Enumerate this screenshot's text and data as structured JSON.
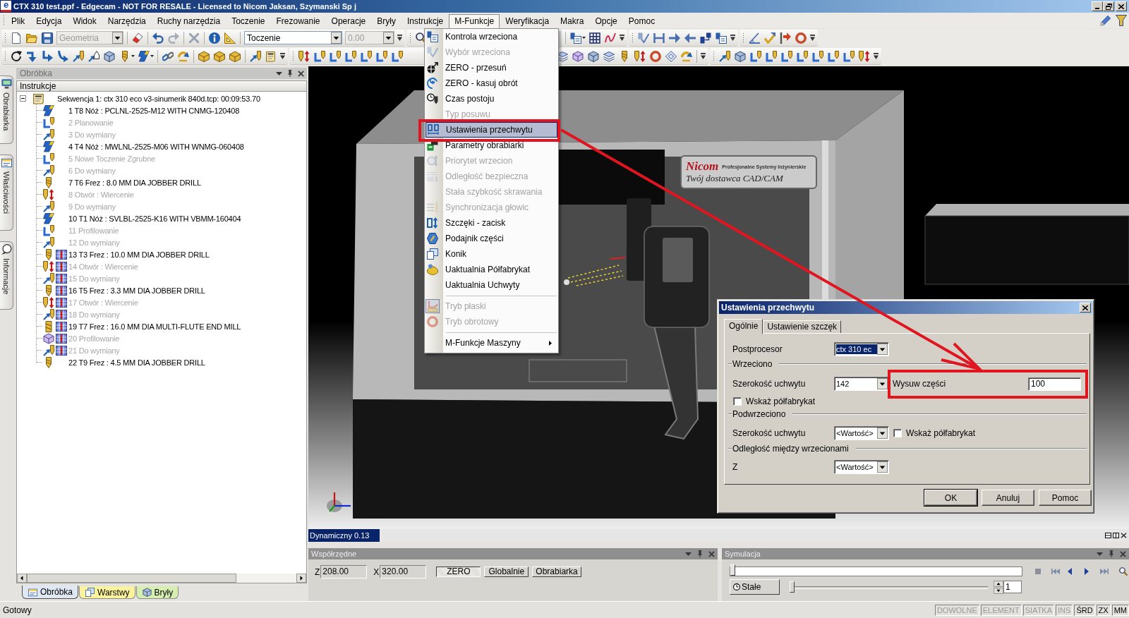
{
  "title_bar": {
    "logo": "e",
    "title": "CTX 310 test.ppf - Edgecam - NOT FOR RESALE - Licensed to Nicom Jaksan, Szymanski Sp j"
  },
  "menu_bar": [
    {
      "label": "Plik",
      "selected": false
    },
    {
      "label": "Edycja",
      "selected": false
    },
    {
      "label": "Widok",
      "selected": false
    },
    {
      "label": "Narzędzia",
      "selected": false
    },
    {
      "label": "Ruchy narzędzia",
      "selected": false
    },
    {
      "label": "Toczenie",
      "selected": false
    },
    {
      "label": "Frezowanie",
      "selected": false
    },
    {
      "label": "Operacje",
      "selected": false
    },
    {
      "label": "Bryły",
      "selected": false
    },
    {
      "label": "Instrukcje",
      "selected": false
    },
    {
      "label": "M-Funkcje",
      "selected": true
    },
    {
      "label": "Weryfikacja",
      "selected": false
    },
    {
      "label": "Makra",
      "selected": false
    },
    {
      "label": "Opcje",
      "selected": false
    },
    {
      "label": "Pomoc",
      "selected": false
    }
  ],
  "menu": {
    "sections": [
      {
        "items": [
          {
            "label": "Kontrola wrzeciona",
            "disabled": false,
            "selected": false,
            "checked": false,
            "submenu": false
          },
          {
            "label": "Wybór wrzeciona",
            "disabled": true,
            "selected": false,
            "checked": false,
            "submenu": false
          },
          {
            "label": "ZERO - przesuń",
            "disabled": false,
            "selected": false,
            "checked": false,
            "submenu": false
          },
          {
            "label": "ZERO - kasuj obrót",
            "disabled": false,
            "selected": false,
            "checked": false,
            "submenu": false
          },
          {
            "label": "Czas postoju",
            "disabled": false,
            "selected": false,
            "checked": false,
            "submenu": false
          },
          {
            "label": "Typ posuwu",
            "disabled": true,
            "selected": false,
            "checked": false,
            "submenu": false
          },
          {
            "label": "Ustawienia przechwytu",
            "disabled": false,
            "selected": true,
            "checked": false,
            "submenu": false
          },
          {
            "label": "Parametry obrabiarki",
            "disabled": false,
            "selected": false,
            "checked": false,
            "submenu": false
          },
          {
            "label": "Priorytet wrzecion",
            "disabled": true,
            "selected": false,
            "checked": false,
            "submenu": false
          },
          {
            "label": "Odległość bezpieczna",
            "disabled": true,
            "selected": false,
            "checked": false,
            "submenu": false
          },
          {
            "label": "Stała szybkość skrawania",
            "disabled": true,
            "selected": false,
            "checked": false,
            "submenu": false
          },
          {
            "label": "Synchronizacja głowic",
            "disabled": true,
            "selected": false,
            "checked": false,
            "submenu": false
          },
          {
            "label": "Szczęki - zacisk",
            "disabled": false,
            "selected": false,
            "checked": false,
            "submenu": false
          },
          {
            "label": "Podajnik części",
            "disabled": false,
            "selected": false,
            "checked": false,
            "submenu": false
          },
          {
            "label": "Konik",
            "disabled": false,
            "selected": false,
            "checked": false,
            "submenu": false
          },
          {
            "label": "Uaktualnia Półfabrykat",
            "disabled": false,
            "selected": false,
            "checked": false,
            "submenu": false
          },
          {
            "label": "Uaktualnia Uchwyty",
            "disabled": false,
            "selected": false,
            "checked": false,
            "submenu": false
          }
        ]
      },
      {
        "items": [
          {
            "label": "Tryb płaski",
            "disabled": true,
            "selected": false,
            "checked": true,
            "submenu": false
          },
          {
            "label": "Tryb obrotowy",
            "disabled": true,
            "selected": false,
            "checked": false,
            "submenu": false
          }
        ]
      },
      {
        "items": [
          {
            "label": "M-Funkcje Maszyny",
            "disabled": false,
            "selected": false,
            "checked": false,
            "submenu": true
          }
        ]
      }
    ]
  },
  "toolbar": {
    "combos": [
      {
        "value": "Geometria",
        "disabled": true
      },
      {
        "value": "Toczenie",
        "disabled": false
      },
      {
        "value": "0.00",
        "disabled": true
      }
    ]
  },
  "side_tabs": [
    {
      "label": "Obrabiarka"
    },
    {
      "label": "Właściwości"
    },
    {
      "label": "Informacje"
    }
  ],
  "machining_panel": {
    "title": "Obróbka",
    "column": "Instrukcje",
    "tree": {
      "label": "Sekwencja 1: ctx 310 eco v3-sinumerik 840d.tcp: 00:09:53.70",
      "expanded": true,
      "children": [
        {
          "label": "1 T8 Nóż : PCLNL-2525-M12 WITH CNMG-120408",
          "disabled": false
        },
        {
          "label": "2 Planowanie",
          "disabled": true
        },
        {
          "label": "3 Do wymiany",
          "disabled": true
        },
        {
          "label": "4 T4 Nóż : MWLNL-2525-M06 WITH WNMG-060408",
          "disabled": false
        },
        {
          "label": "5 Nowe Toczenie Zgrubne",
          "disabled": true
        },
        {
          "label": "6 Do wymiany",
          "disabled": true
        },
        {
          "label": "7 T6 Frez : 8.0 MM DIA JOBBER DRILL",
          "disabled": false
        },
        {
          "label": "8 Otwór : Wiercenie",
          "disabled": true
        },
        {
          "label": "9 Do wymiany",
          "disabled": true
        },
        {
          "label": "10 T1 Nóż : SVLBL-2525-K16 WITH VBMM-160404",
          "disabled": false
        },
        {
          "label": "11 Profilowanie",
          "disabled": true
        },
        {
          "label": "12 Do wymiany",
          "disabled": true
        },
        {
          "label": "13 T3 Frez : 10.0 MM DIA JOBBER DRILL",
          "disabled": false
        },
        {
          "label": "14 Otwór : Wiercenie",
          "disabled": true
        },
        {
          "label": "15 Do wymiany",
          "disabled": true
        },
        {
          "label": "16 T5 Frez : 3.3 MM DIA JOBBER DRILL",
          "disabled": false
        },
        {
          "label": "17 Otwór : Wiercenie",
          "disabled": true
        },
        {
          "label": "18 Do wymiany",
          "disabled": true
        },
        {
          "label": "19 T7 Frez : 16.0 MM DIA MULTI-FLUTE END MILL",
          "disabled": false
        },
        {
          "label": "20 Profilowanie",
          "disabled": true
        },
        {
          "label": "21 Do wymiany",
          "disabled": true
        },
        {
          "label": "22 T9 Frez : 4.5 MM DIA JOBBER DRILL",
          "disabled": false
        }
      ]
    },
    "tabs": [
      {
        "label": "Obróbka",
        "selected": true,
        "color": "#dfe7f3"
      },
      {
        "label": "Warstwy",
        "selected": false,
        "color": "#fbf29c"
      },
      {
        "label": "Bryły",
        "selected": false,
        "color": "#d6eeb0"
      }
    ]
  },
  "viewport": {
    "sign": {
      "brand": "Nicom",
      "tagline": "Profesjonalne Systemy Inżynierskie",
      "slogan": "Twój dostawca CAD/CAM"
    },
    "view_mode": "Dynamiczny 0.13"
  },
  "dialog": {
    "title": "Ustawienia przechwytu",
    "tabs": [
      {
        "label": "Ogólnie",
        "selected": true
      },
      {
        "label": "Ustawienie szczęk",
        "selected": false
      }
    ],
    "postprocessor": {
      "label": "Postprocesor",
      "value": "ctx 310 ec",
      "focused": true
    },
    "spindle": {
      "title": "Wrzeciono",
      "chuck_width": {
        "label": "Szerokość uchwytu",
        "value": "142"
      },
      "part_extension": {
        "label": "Wysuw części",
        "value": "100"
      },
      "show_stock": {
        "label": "Wskaż półfabrykat",
        "checked": false
      }
    },
    "sub_spindle": {
      "title": "Podwrzeciono",
      "chuck_width": {
        "label": "Szerokość uchwytu",
        "value": "<Wartość>"
      },
      "show_stock": {
        "label": "Wskaż półfabrykat",
        "checked": false
      }
    },
    "spindle_distance": {
      "title": "Odległość między wrzecionami",
      "z": {
        "label": "Z",
        "value": "<Wartość>"
      }
    },
    "buttons": [
      {
        "label": "OK",
        "default": true
      },
      {
        "label": "Anuluj",
        "default": false
      },
      {
        "label": "Pomoc",
        "default": false
      }
    ]
  },
  "coordinates_panel": {
    "title": "Współrzędne",
    "fields": [
      {
        "label": "Z",
        "value": "208.00"
      },
      {
        "label": "X",
        "value": "320.00"
      }
    ],
    "buttons": [
      {
        "label": "ZERO",
        "pressed": true
      },
      {
        "label": "Globalnie",
        "pressed": false
      },
      {
        "label": "Obrabiarka",
        "pressed": false
      }
    ]
  },
  "simulation_panel": {
    "title": "Symulacja",
    "timeline": {
      "level": 0
    },
    "mode_button": "Stałe",
    "speed": {
      "level": 0
    },
    "step": "1"
  },
  "status_bar": {
    "message": "Gotowy",
    "indicators": [
      {
        "label": "DOWOLNE",
        "active": false
      },
      {
        "label": "ELEMENT",
        "active": false
      },
      {
        "label": "SIATKA",
        "active": false
      },
      {
        "label": "INS",
        "active": false
      },
      {
        "label": "ŚRD",
        "active": true
      },
      {
        "label": "ZX",
        "active": true
      },
      {
        "label": "MM",
        "active": true
      }
    ]
  }
}
